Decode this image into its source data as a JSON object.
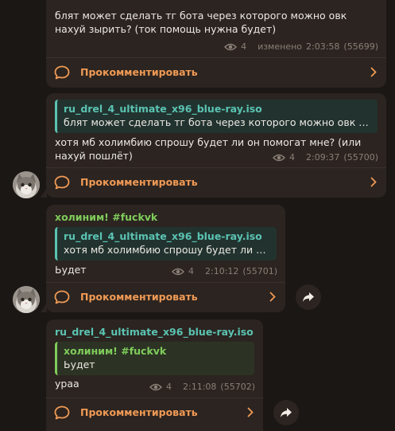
{
  "messages": [
    {
      "text": "блят может сделать тг бота через которого можно овк нахуй зырить? (ток помощь нужна будет)",
      "views": "4",
      "edited_label": "изменено",
      "time": "2:03:58",
      "msg_id": "(55699)",
      "comment_label": "Прокомментировать"
    },
    {
      "reply_name": "ru_drel_4_ultimate_x96_blue-ray.iso",
      "reply_text": "блят может сделать тг бота через которого можно овк наху...",
      "text": "хотя мб холимбию спрошу будет ли он помогат мне? (или нахуй пошлёт)",
      "views": "4",
      "time": "2:09:37",
      "msg_id": "(55700)",
      "comment_label": "Прокомментировать"
    },
    {
      "sender": "холиним! #fuckvk",
      "reply_name": "ru_drel_4_ultimate_x96_blue-ray.iso",
      "reply_text": "хотя мб холимбию спрошу будет ли он ...",
      "text": "Ьудет",
      "views": "4",
      "time": "2:10:12",
      "msg_id": "(55701)",
      "comment_label": "Прокомментировать"
    },
    {
      "sender": "ru_drel_4_ultimate_x96_blue-ray.iso",
      "reply_name": "холиним! #fuckvk",
      "reply_text": "Ьудет",
      "text": "ураа",
      "views": "4",
      "time": "2:11:08",
      "msg_id": "(55702)",
      "comment_label": "Прокомментировать"
    }
  ],
  "icons": {
    "views": "eye-icon",
    "comment": "comment-icon",
    "chevron": "chevron-right-icon",
    "share": "share-icon",
    "avatar": "cat-avatar"
  },
  "colors": {
    "background": "#1b1714",
    "bubble": "#2b2420",
    "accent_orange": "#f09a55",
    "accent_green": "#7fcc5b",
    "accent_teal": "#5bc3b2"
  }
}
